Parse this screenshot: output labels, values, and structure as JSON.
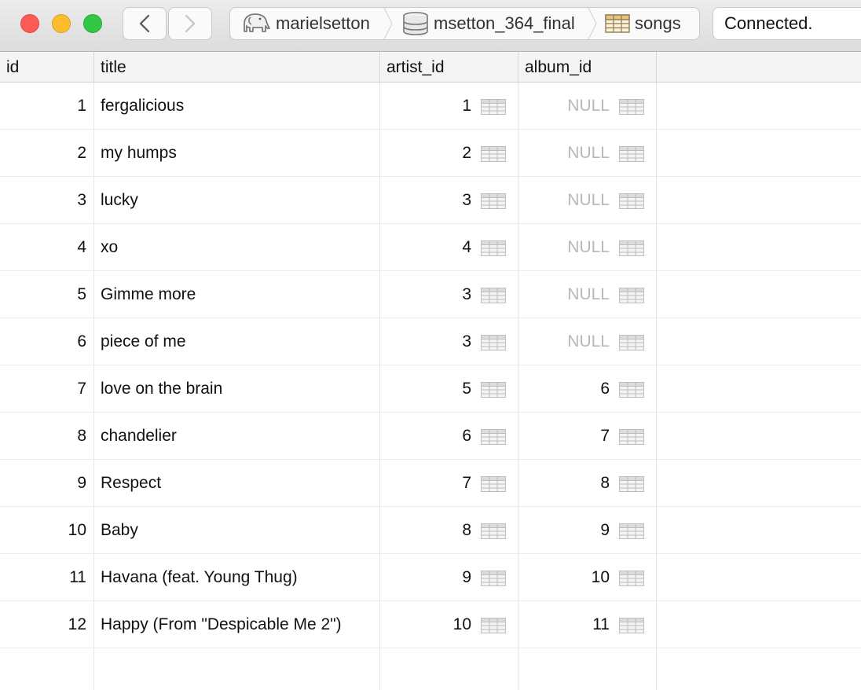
{
  "window": {
    "breadcrumbs": [
      {
        "label": "marielsetton",
        "icon": "elephant-icon"
      },
      {
        "label": "msetton_364_final",
        "icon": "database-icon"
      },
      {
        "label": "songs",
        "icon": "table-icon"
      }
    ],
    "status": "Connected.",
    "traffic_light_colors": {
      "close": "#fc5b57",
      "minimize": "#fdbc2e",
      "maximize": "#33c748"
    }
  },
  "table": {
    "columns": [
      "id",
      "title",
      "artist_id",
      "album_id"
    ],
    "rows": [
      {
        "id": "1",
        "title": "fergalicious",
        "artist_id": "1",
        "album_id": "NULL"
      },
      {
        "id": "2",
        "title": "my humps",
        "artist_id": "2",
        "album_id": "NULL"
      },
      {
        "id": "3",
        "title": "lucky",
        "artist_id": "3",
        "album_id": "NULL"
      },
      {
        "id": "4",
        "title": "xo",
        "artist_id": "4",
        "album_id": "NULL"
      },
      {
        "id": "5",
        "title": "Gimme more",
        "artist_id": "3",
        "album_id": "NULL"
      },
      {
        "id": "6",
        "title": "piece of me",
        "artist_id": "3",
        "album_id": "NULL"
      },
      {
        "id": "7",
        "title": "love on the brain",
        "artist_id": "5",
        "album_id": "6"
      },
      {
        "id": "8",
        "title": "chandelier",
        "artist_id": "6",
        "album_id": "7"
      },
      {
        "id": "9",
        "title": "Respect",
        "artist_id": "7",
        "album_id": "8"
      },
      {
        "id": "10",
        "title": "Baby",
        "artist_id": "8",
        "album_id": "9"
      },
      {
        "id": "11",
        "title": "Havana (feat. Young Thug)",
        "artist_id": "9",
        "album_id": "10"
      },
      {
        "id": "12",
        "title": "Happy (From \"Despicable Me 2\")",
        "artist_id": "10",
        "album_id": "11"
      }
    ],
    "foreign_key_icon": "foreign-key-table-icon"
  }
}
